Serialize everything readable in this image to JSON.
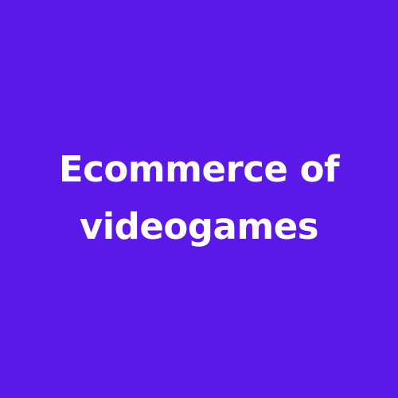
{
  "colors": {
    "background": "#5b19e8",
    "text": "#ffffff"
  },
  "title": {
    "line1": "Ecommerce of",
    "line2": "videogames"
  }
}
